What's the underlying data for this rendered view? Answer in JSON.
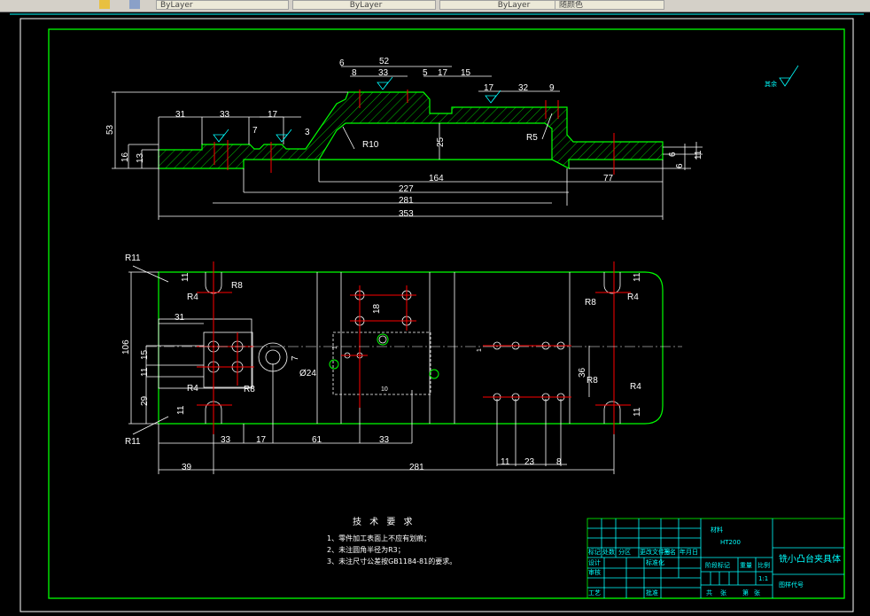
{
  "toolbar": {
    "layer_color": "ByLayer",
    "linetype": "ByLayer",
    "lineweight": "ByLayer",
    "plot_style": "随颜色"
  },
  "colors": {
    "outline": "#00ff00",
    "dimension": "#ffffff",
    "centerline": "#ff0000",
    "title_block": "#00ffff",
    "frame": "#00ffff"
  },
  "surface_note": "其余",
  "top_view": {
    "dims": [
      "6",
      "52",
      "8",
      "33",
      "5",
      "17",
      "15",
      "17",
      "32",
      "9",
      "53",
      "31",
      "33",
      "17",
      "7",
      "3",
      "R10",
      "25",
      "R5",
      "164",
      "227",
      "281",
      "353",
      "16",
      "13",
      "77",
      "6",
      "11",
      "6"
    ]
  },
  "plan_view": {
    "dims": [
      "R11",
      "11",
      "R8",
      "R4",
      "31",
      "106",
      "15",
      "11",
      "29",
      "R4",
      "R8",
      "R11",
      "11",
      "33",
      "17",
      "61",
      "33",
      "39",
      "281",
      "Ø24",
      "7",
      "18",
      "1",
      "10",
      "R8",
      "R4",
      "11",
      "36",
      "R8",
      "R4",
      "11",
      "11",
      "23",
      "8",
      "1"
    ]
  },
  "tech_requirements": {
    "title": "技 术 要 求",
    "items": [
      "1、零件加工表面上不应有划痕；",
      "2、未注圆角半径为R3；",
      "3、未注尺寸公差按GB1184-81的要求。"
    ]
  },
  "title_block": {
    "material_label": "材料",
    "material": "HT200",
    "part_name": "铣小凸台夹具体",
    "drawing_no": "图样代号",
    "scale": "1:1",
    "labels": [
      "标记",
      "处数",
      "分区",
      "更改文件号",
      "签名",
      "年月日",
      "设计",
      "标准化",
      "审核",
      "工艺",
      "批准",
      "阶段标记",
      "重量",
      "比例",
      "共",
      "张",
      "第",
      "张"
    ]
  }
}
